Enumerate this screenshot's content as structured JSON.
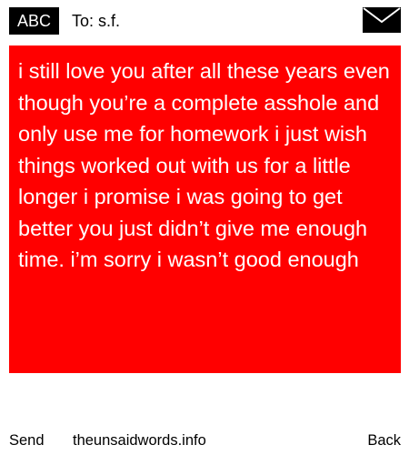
{
  "header": {
    "badge_label": "ABC",
    "to_label": "To:",
    "recipient": "s.f.",
    "compose_icon": "envelope-icon"
  },
  "message": {
    "text": "i still love you after all these years even though you’re a complete asshole and only use me for homework i just wish things worked out with us for a little longer i promise i was going to get better you just didn’t give me enough time. i’m sorry i wasn’t good enough",
    "background_color": "#ff0000",
    "text_color": "#ffffff"
  },
  "footer": {
    "send_label": "Send",
    "site_label": "theunsaidwords.info",
    "back_label": "Back"
  }
}
